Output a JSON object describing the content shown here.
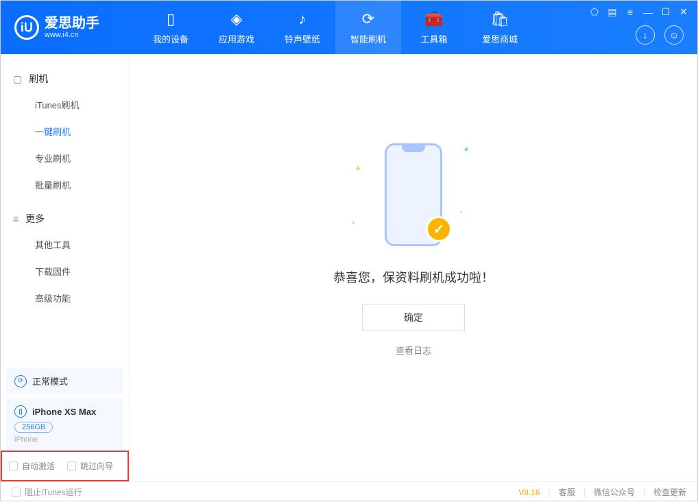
{
  "app": {
    "name": "爱思助手",
    "url": "www.i4.cn"
  },
  "tabs": [
    {
      "label": "我的设备"
    },
    {
      "label": "应用游戏"
    },
    {
      "label": "铃声壁纸"
    },
    {
      "label": "智能刷机"
    },
    {
      "label": "工具箱"
    },
    {
      "label": "爱思商城"
    }
  ],
  "sidebar": {
    "section1_title": "刷机",
    "items1": [
      "iTunes刷机",
      "一键刷机",
      "专业刷机",
      "批量刷机"
    ],
    "section2_title": "更多",
    "items2": [
      "其他工具",
      "下载固件",
      "高级功能"
    ],
    "mode_label": "正常模式",
    "device_name": "iPhone XS Max",
    "device_capacity": "256GB",
    "device_type": "iPhone",
    "checkbox1": "自动激活",
    "checkbox2": "跳过向导"
  },
  "main": {
    "success_text": "恭喜您，保资料刷机成功啦！",
    "ok_label": "确定",
    "log_link": "查看日志"
  },
  "footer": {
    "left_label": "阻止iTunes运行",
    "version": "V8.16",
    "link1": "客服",
    "link2": "微信公众号",
    "link3": "检查更新"
  }
}
